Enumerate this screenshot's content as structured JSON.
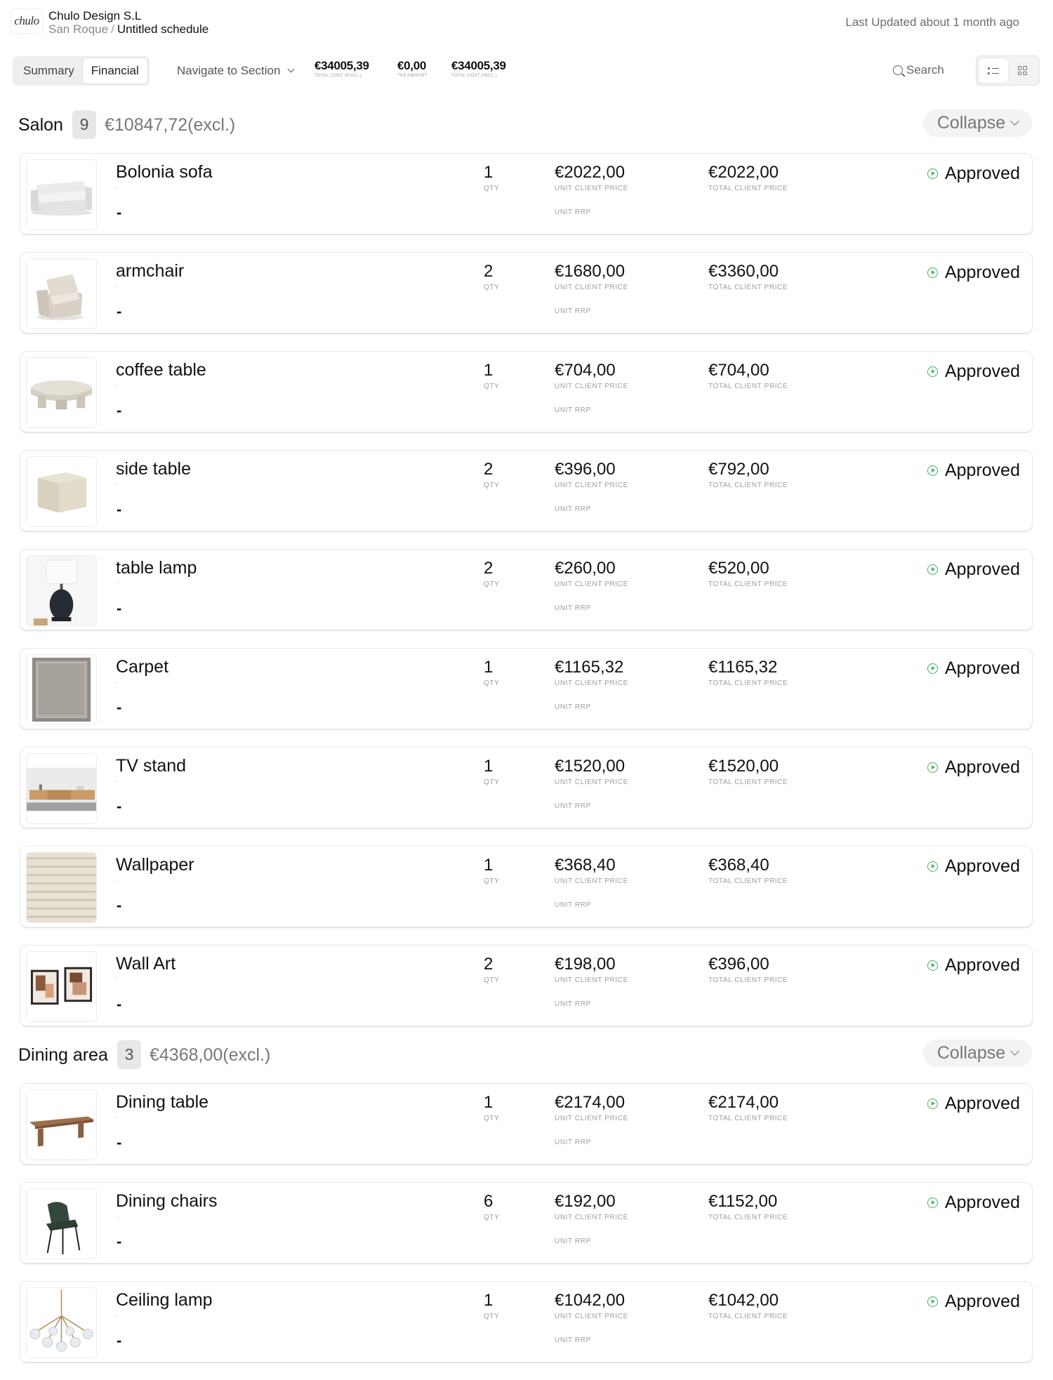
{
  "header": {
    "logo_text": "chulo",
    "company": "Chulo Design S.L",
    "breadcrumb_project": "San Roque",
    "breadcrumb_separator": "/",
    "breadcrumb_schedule": "Untitled schedule",
    "last_updated": "Last Updated about 1 month ago"
  },
  "toolbar": {
    "tabs": [
      {
        "label": "Summary",
        "active": false
      },
      {
        "label": "Financial",
        "active": true
      }
    ],
    "navigate_label": "Navigate to Section",
    "metrics": [
      {
        "value": "€34005,39",
        "label": "TOTAL COST (EXCL.)"
      },
      {
        "value": "€0,00",
        "label": "TAX AMOUNT"
      },
      {
        "value": "€34005,39",
        "label": "TOTAL COST (INCL.)"
      }
    ],
    "search_label": "Search",
    "view_mode": "list"
  },
  "labels": {
    "qty": "QTY",
    "unit_client_price": "UNIT CLIENT PRICE",
    "unit_rrp": "UNIT RRP",
    "total_client_price": "TOTAL CLIENT PRICE",
    "collapse": "Collapse",
    "item_dot": "-",
    "item_dash": "-"
  },
  "colors": {
    "approved": "#3fb560"
  },
  "sections": [
    {
      "name": "Salon",
      "count": "9",
      "subtotal": "€10847,72(excl.)",
      "items": [
        {
          "name": "Bolonia sofa",
          "qty": "1",
          "unit_price": "€2022,00",
          "total_price": "€2022,00",
          "status": "Approved",
          "image": "sofa"
        },
        {
          "name": "armchair",
          "qty": "2",
          "unit_price": "€1680,00",
          "total_price": "€3360,00",
          "status": "Approved",
          "image": "armchair"
        },
        {
          "name": "coffee table",
          "qty": "1",
          "unit_price": "€704,00",
          "total_price": "€704,00",
          "status": "Approved",
          "image": "coffee-table"
        },
        {
          "name": "side table",
          "qty": "2",
          "unit_price": "€396,00",
          "total_price": "€792,00",
          "status": "Approved",
          "image": "side-table"
        },
        {
          "name": "table lamp",
          "qty": "2",
          "unit_price": "€260,00",
          "total_price": "€520,00",
          "status": "Approved",
          "image": "table-lamp"
        },
        {
          "name": "Carpet",
          "qty": "1",
          "unit_price": "€1165,32",
          "total_price": "€1165,32",
          "status": "Approved",
          "image": "carpet"
        },
        {
          "name": "TV stand",
          "qty": "1",
          "unit_price": "€1520,00",
          "total_price": "€1520,00",
          "status": "Approved",
          "image": "tv-stand"
        },
        {
          "name": "Wallpaper",
          "qty": "1",
          "unit_price": "€368,40",
          "total_price": "€368,40",
          "status": "Approved",
          "image": "wallpaper"
        },
        {
          "name": "Wall Art",
          "qty": "2",
          "unit_price": "€198,00",
          "total_price": "€396,00",
          "status": "Approved",
          "image": "wall-art"
        }
      ]
    },
    {
      "name": "Dining area",
      "count": "3",
      "subtotal": "€4368,00(excl.)",
      "items": [
        {
          "name": "Dining table",
          "qty": "1",
          "unit_price": "€2174,00",
          "total_price": "€2174,00",
          "status": "Approved",
          "image": "dining-table"
        },
        {
          "name": "Dining chairs",
          "qty": "6",
          "unit_price": "€192,00",
          "total_price": "€1152,00",
          "status": "Approved",
          "image": "dining-chair"
        },
        {
          "name": "Ceiling lamp",
          "qty": "1",
          "unit_price": "€1042,00",
          "total_price": "€1042,00",
          "status": "Approved",
          "image": "ceiling-lamp"
        }
      ]
    }
  ]
}
